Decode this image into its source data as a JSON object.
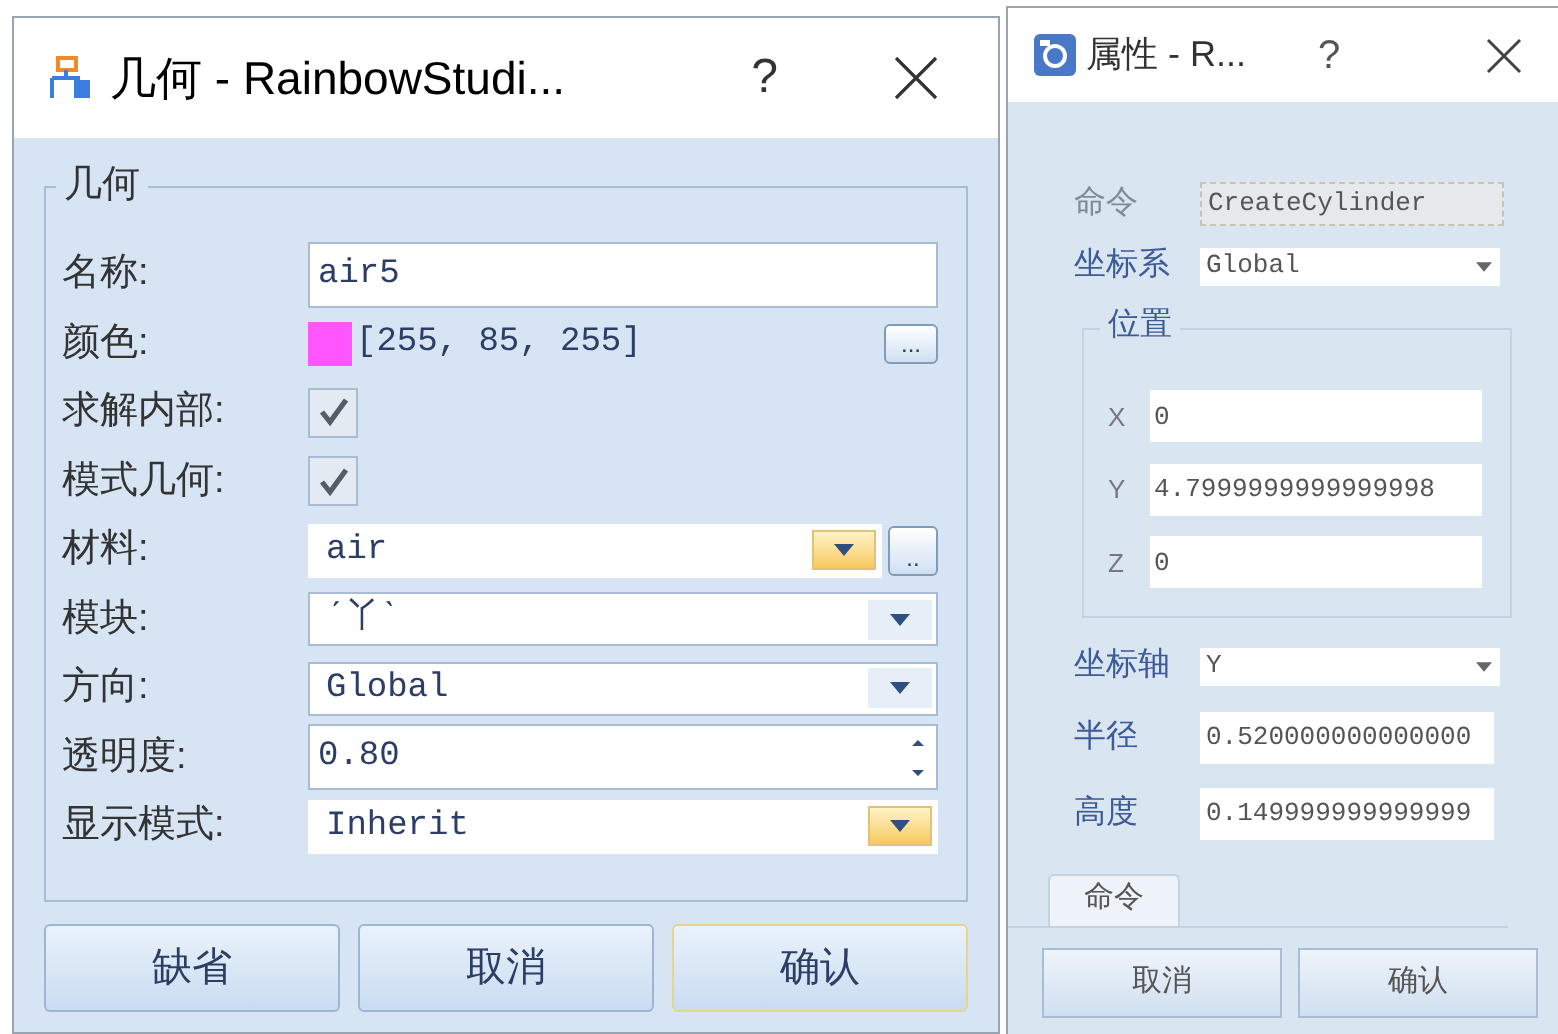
{
  "geometry_dialog": {
    "title": "几何 - RainbowStudi...",
    "help": "?",
    "group_title": "几何",
    "rows": [
      {
        "kind": "text",
        "label": "名称:",
        "value": "air5"
      },
      {
        "kind": "color",
        "label": "颜色:",
        "color": "#ff55ff",
        "value": "[255, 85, 255]",
        "browse": "..."
      },
      {
        "kind": "checkbox",
        "label": "求解内部:",
        "checked": true
      },
      {
        "kind": "checkbox",
        "label": "模式几何:",
        "checked": true
      },
      {
        "kind": "combo",
        "label": "材料:",
        "value": "air",
        "highlighted": true,
        "browse": ".."
      },
      {
        "kind": "combo",
        "label": "模块:",
        "value": "ˊ丫ˋ",
        "highlighted": false
      },
      {
        "kind": "combo",
        "label": "方向:",
        "value": "Global",
        "highlighted": false
      },
      {
        "kind": "spin",
        "label": "透明度:",
        "value": "0.80"
      },
      {
        "kind": "combo",
        "label": "显示模式:",
        "value": "Inherit",
        "highlighted": true
      }
    ],
    "buttons": [
      {
        "label": "缺省",
        "default": false
      },
      {
        "label": "取消",
        "default": false
      },
      {
        "label": "确认",
        "default": true
      }
    ]
  },
  "properties_dialog": {
    "title": "属性 - R...",
    "help": "?",
    "command": {
      "label": "命令",
      "value": "CreateCylinder",
      "disabled": true
    },
    "coordinate_system": {
      "label": "坐标系",
      "value": "Global"
    },
    "position": {
      "title": "位置",
      "fields": [
        {
          "label": "X",
          "value": "0"
        },
        {
          "label": "Y",
          "value": "4.7999999999999998"
        },
        {
          "label": "Z",
          "value": "0"
        }
      ]
    },
    "axis": {
      "label": "坐标轴",
      "value": "Y"
    },
    "radius": {
      "label": "半径",
      "value": "0.520000000000000"
    },
    "height": {
      "label": "高度",
      "value": "0.149999999999999"
    },
    "tabs": [
      {
        "label": "命令",
        "selected": true
      }
    ],
    "buttons": [
      {
        "label": "取消"
      },
      {
        "label": "确认"
      }
    ]
  }
}
